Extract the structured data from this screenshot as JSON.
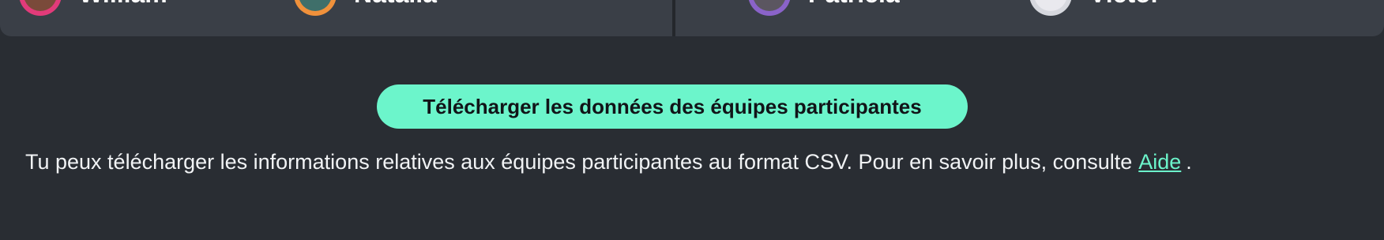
{
  "teams": {
    "left": {
      "members": [
        {
          "name": "William",
          "avatar_color": "#e23b7a"
        },
        {
          "name": "Natalia",
          "avatar_color": "#f0913b"
        }
      ]
    },
    "right": {
      "members": [
        {
          "name": "Patricia",
          "avatar_color": "#8a63c9"
        },
        {
          "name": "Victor",
          "avatar_color": "#d6d8de"
        }
      ]
    }
  },
  "download": {
    "button_label": "Télécharger les données des équipes participantes"
  },
  "info": {
    "text": "Tu peux télécharger les informations relatives aux équipes participantes au format CSV. Pour en savoir plus, consulte",
    "link_label": "Aide",
    "trailing": "."
  },
  "colors": {
    "background": "#292d33",
    "card": "#3a3f47",
    "accent": "#6cf5cb"
  }
}
